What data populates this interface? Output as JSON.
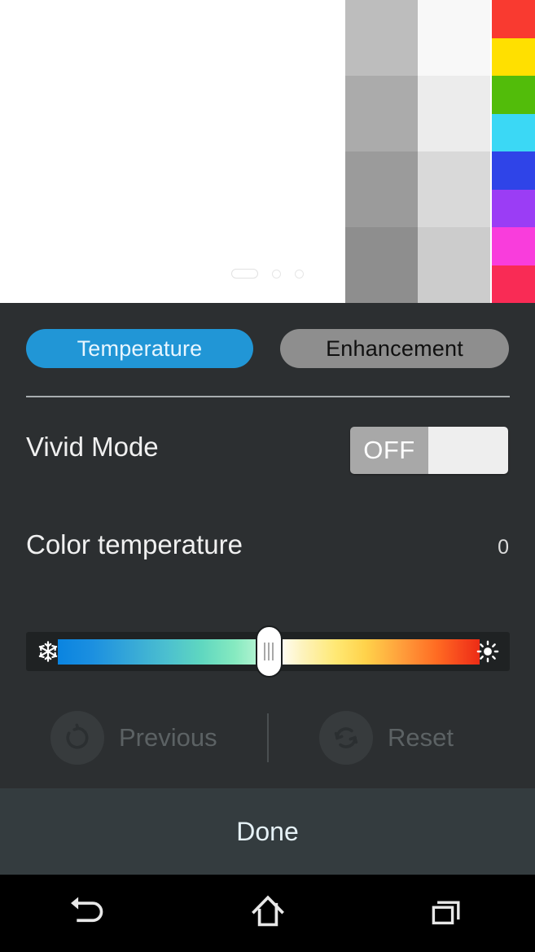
{
  "preview": {
    "background_color": "#ffffff",
    "gray_columns": [
      {
        "name": "gray-column-light",
        "cells": [
          "#bdbdbd",
          "#ababab",
          "#9b9b9b",
          "#8e8e8e"
        ]
      },
      {
        "name": "gray-column-lighter",
        "cells": [
          "#f8f8f8",
          "#ececec",
          "#d9d9d9",
          "#cccccc"
        ]
      }
    ],
    "color_strip": [
      "#f93a30",
      "#ffe000",
      "#52bc0a",
      "#3bd8f5",
      "#2f44e8",
      "#9b3df5",
      "#f93ddc",
      "#f92b55"
    ],
    "page_indicator": {
      "active_index": 0,
      "count": 3
    }
  },
  "panel": {
    "tabs": [
      {
        "id": "temperature",
        "label": "Temperature",
        "active": true,
        "color": "#2196d6"
      },
      {
        "id": "enhancement",
        "label": "Enhancement",
        "active": false,
        "color": "#8e8e8e"
      }
    ],
    "vivid_mode": {
      "label": "Vivid Mode",
      "toggle_state": "OFF",
      "enabled": false
    },
    "color_temperature": {
      "label": "Color temperature",
      "value": "0",
      "min": -50,
      "max": 50,
      "slider_percent": 50,
      "cold_icon": "snowflake-icon",
      "warm_icon": "sun-icon"
    },
    "actions": [
      {
        "id": "previous",
        "label": "Previous",
        "icon": "undo-icon",
        "disabled": true
      },
      {
        "id": "reset",
        "label": "Reset",
        "icon": "refresh-icon",
        "disabled": true
      }
    ]
  },
  "done_bar": {
    "label": "Done"
  },
  "nav_bar": {
    "buttons": [
      {
        "id": "back",
        "icon": "back-arrow-icon"
      },
      {
        "id": "home",
        "icon": "home-icon"
      },
      {
        "id": "recents",
        "icon": "recents-icon"
      }
    ]
  }
}
